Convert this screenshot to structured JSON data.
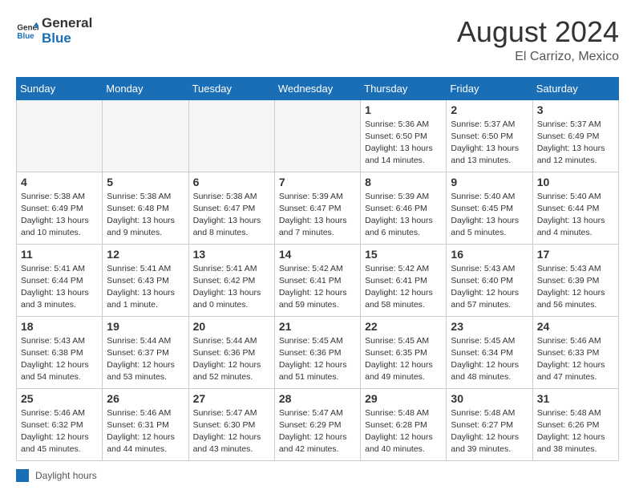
{
  "header": {
    "logo_line1": "General",
    "logo_line2": "Blue",
    "month_year": "August 2024",
    "location": "El Carrizo, Mexico"
  },
  "days_of_week": [
    "Sunday",
    "Monday",
    "Tuesday",
    "Wednesday",
    "Thursday",
    "Friday",
    "Saturday"
  ],
  "legend": {
    "label": "Daylight hours"
  },
  "weeks": [
    [
      {
        "day": "",
        "info": ""
      },
      {
        "day": "",
        "info": ""
      },
      {
        "day": "",
        "info": ""
      },
      {
        "day": "",
        "info": ""
      },
      {
        "day": "1",
        "info": "Sunrise: 5:36 AM\nSunset: 6:50 PM\nDaylight: 13 hours and 14 minutes."
      },
      {
        "day": "2",
        "info": "Sunrise: 5:37 AM\nSunset: 6:50 PM\nDaylight: 13 hours and 13 minutes."
      },
      {
        "day": "3",
        "info": "Sunrise: 5:37 AM\nSunset: 6:49 PM\nDaylight: 13 hours and 12 minutes."
      }
    ],
    [
      {
        "day": "4",
        "info": "Sunrise: 5:38 AM\nSunset: 6:49 PM\nDaylight: 13 hours and 10 minutes."
      },
      {
        "day": "5",
        "info": "Sunrise: 5:38 AM\nSunset: 6:48 PM\nDaylight: 13 hours and 9 minutes."
      },
      {
        "day": "6",
        "info": "Sunrise: 5:38 AM\nSunset: 6:47 PM\nDaylight: 13 hours and 8 minutes."
      },
      {
        "day": "7",
        "info": "Sunrise: 5:39 AM\nSunset: 6:47 PM\nDaylight: 13 hours and 7 minutes."
      },
      {
        "day": "8",
        "info": "Sunrise: 5:39 AM\nSunset: 6:46 PM\nDaylight: 13 hours and 6 minutes."
      },
      {
        "day": "9",
        "info": "Sunrise: 5:40 AM\nSunset: 6:45 PM\nDaylight: 13 hours and 5 minutes."
      },
      {
        "day": "10",
        "info": "Sunrise: 5:40 AM\nSunset: 6:44 PM\nDaylight: 13 hours and 4 minutes."
      }
    ],
    [
      {
        "day": "11",
        "info": "Sunrise: 5:41 AM\nSunset: 6:44 PM\nDaylight: 13 hours and 3 minutes."
      },
      {
        "day": "12",
        "info": "Sunrise: 5:41 AM\nSunset: 6:43 PM\nDaylight: 13 hours and 1 minute."
      },
      {
        "day": "13",
        "info": "Sunrise: 5:41 AM\nSunset: 6:42 PM\nDaylight: 13 hours and 0 minutes."
      },
      {
        "day": "14",
        "info": "Sunrise: 5:42 AM\nSunset: 6:41 PM\nDaylight: 12 hours and 59 minutes."
      },
      {
        "day": "15",
        "info": "Sunrise: 5:42 AM\nSunset: 6:41 PM\nDaylight: 12 hours and 58 minutes."
      },
      {
        "day": "16",
        "info": "Sunrise: 5:43 AM\nSunset: 6:40 PM\nDaylight: 12 hours and 57 minutes."
      },
      {
        "day": "17",
        "info": "Sunrise: 5:43 AM\nSunset: 6:39 PM\nDaylight: 12 hours and 56 minutes."
      }
    ],
    [
      {
        "day": "18",
        "info": "Sunrise: 5:43 AM\nSunset: 6:38 PM\nDaylight: 12 hours and 54 minutes."
      },
      {
        "day": "19",
        "info": "Sunrise: 5:44 AM\nSunset: 6:37 PM\nDaylight: 12 hours and 53 minutes."
      },
      {
        "day": "20",
        "info": "Sunrise: 5:44 AM\nSunset: 6:36 PM\nDaylight: 12 hours and 52 minutes."
      },
      {
        "day": "21",
        "info": "Sunrise: 5:45 AM\nSunset: 6:36 PM\nDaylight: 12 hours and 51 minutes."
      },
      {
        "day": "22",
        "info": "Sunrise: 5:45 AM\nSunset: 6:35 PM\nDaylight: 12 hours and 49 minutes."
      },
      {
        "day": "23",
        "info": "Sunrise: 5:45 AM\nSunset: 6:34 PM\nDaylight: 12 hours and 48 minutes."
      },
      {
        "day": "24",
        "info": "Sunrise: 5:46 AM\nSunset: 6:33 PM\nDaylight: 12 hours and 47 minutes."
      }
    ],
    [
      {
        "day": "25",
        "info": "Sunrise: 5:46 AM\nSunset: 6:32 PM\nDaylight: 12 hours and 45 minutes."
      },
      {
        "day": "26",
        "info": "Sunrise: 5:46 AM\nSunset: 6:31 PM\nDaylight: 12 hours and 44 minutes."
      },
      {
        "day": "27",
        "info": "Sunrise: 5:47 AM\nSunset: 6:30 PM\nDaylight: 12 hours and 43 minutes."
      },
      {
        "day": "28",
        "info": "Sunrise: 5:47 AM\nSunset: 6:29 PM\nDaylight: 12 hours and 42 minutes."
      },
      {
        "day": "29",
        "info": "Sunrise: 5:48 AM\nSunset: 6:28 PM\nDaylight: 12 hours and 40 minutes."
      },
      {
        "day": "30",
        "info": "Sunrise: 5:48 AM\nSunset: 6:27 PM\nDaylight: 12 hours and 39 minutes."
      },
      {
        "day": "31",
        "info": "Sunrise: 5:48 AM\nSunset: 6:26 PM\nDaylight: 12 hours and 38 minutes."
      }
    ]
  ]
}
